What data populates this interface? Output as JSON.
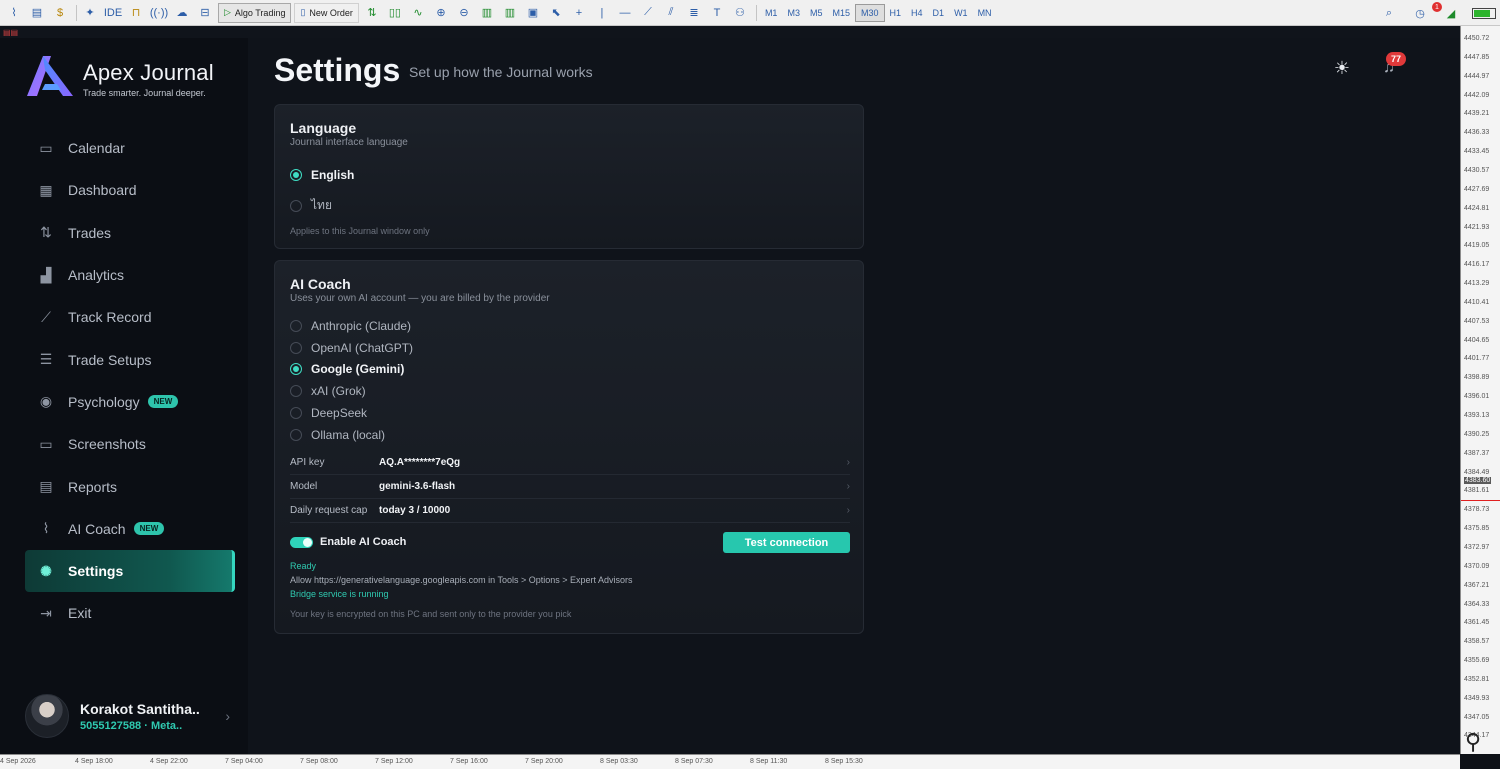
{
  "toolbar": {
    "algo_trading": "Algo Trading",
    "new_order": "New Order",
    "ide": "IDE",
    "timeframes": [
      "M1",
      "M3",
      "M5",
      "M15",
      "M30",
      "H1",
      "H4",
      "D1",
      "W1",
      "MN"
    ],
    "active_timeframe": "M30",
    "alert_count": "1"
  },
  "app": {
    "name": "Apex Journal",
    "tagline": "Trade smarter. Journal deeper."
  },
  "nav": [
    {
      "label": "Calendar",
      "icon": "calendar-icon"
    },
    {
      "label": "Dashboard",
      "icon": "dashboard-grid-icon"
    },
    {
      "label": "Trades",
      "icon": "trades-arrows-icon"
    },
    {
      "label": "Analytics",
      "icon": "bar-chart-icon"
    },
    {
      "label": "Track Record",
      "icon": "line-chart-icon"
    },
    {
      "label": "Trade Setups",
      "icon": "sliders-icon"
    },
    {
      "label": "Psychology",
      "icon": "target-icon",
      "badge": "NEW"
    },
    {
      "label": "Screenshots",
      "icon": "image-icon"
    },
    {
      "label": "Reports",
      "icon": "document-icon"
    },
    {
      "label": "AI Coach",
      "icon": "pulse-icon",
      "badge": "NEW"
    },
    {
      "label": "Settings",
      "icon": "gear-icon",
      "active": true
    },
    {
      "label": "Exit",
      "icon": "exit-icon"
    }
  ],
  "user": {
    "name": "Korakot Santitha..",
    "account": "5055127588",
    "platform": "Meta.."
  },
  "header": {
    "title": "Settings",
    "subtitle": "Set up how the Journal works",
    "notification_count": "77"
  },
  "language": {
    "title": "Language",
    "subtitle": "Journal interface language",
    "options": [
      "English",
      "ไทย"
    ],
    "selected": "English",
    "note": "Applies to this Journal window only"
  },
  "ai_coach": {
    "title": "AI Coach",
    "subtitle": "Uses your own AI account — you are billed by the provider",
    "providers": [
      "Anthropic (Claude)",
      "OpenAI (ChatGPT)",
      "Google (Gemini)",
      "xAI (Grok)",
      "DeepSeek",
      "Ollama (local)"
    ],
    "selected": "Google (Gemini)",
    "fields": [
      {
        "label": "API key",
        "value": "AQ.A********7eQg"
      },
      {
        "label": "Model",
        "value": "gemini-3.6-flash"
      },
      {
        "label": "Daily request cap",
        "value": "today 3 / 10000"
      }
    ],
    "enable_label": "Enable AI Coach",
    "enabled": true,
    "test_button": "Test connection",
    "status_ready": "Ready",
    "status_allow": "Allow https://generativelanguage.googleapis.com in Tools > Options > Expert Advisors",
    "status_bridge": "Bridge service is running",
    "footnote": "Your key is encrypted on this PC and sent only to the provider you pick"
  },
  "price_axis": [
    "4450.72",
    "4447.85",
    "4444.97",
    "4442.09",
    "4439.21",
    "4436.33",
    "4433.45",
    "4430.57",
    "4427.69",
    "4424.81",
    "4421.93",
    "4419.05",
    "4416.17",
    "4413.29",
    "4410.41",
    "4407.53",
    "4404.65",
    "4401.77",
    "4398.89",
    "4396.01",
    "4393.13",
    "4390.25",
    "4387.37",
    "4384.49",
    "4383.60",
    "4381.61",
    "4378.73",
    "4375.85",
    "4372.97",
    "4370.09",
    "4367.21",
    "4364.33",
    "4361.45",
    "4358.57",
    "4355.69",
    "4352.81",
    "4349.93",
    "4347.05",
    "4344.17"
  ],
  "current_price": "4383.60",
  "time_axis": [
    "4 Sep 2026",
    "4 Sep 18:00",
    "4 Sep 22:00",
    "7 Sep 04:00",
    "7 Sep 08:00",
    "7 Sep 12:00",
    "7 Sep 16:00",
    "7 Sep 20:00",
    "8 Sep 03:30",
    "8 Sep 07:30",
    "8 Sep 11:30",
    "8 Sep 15:30"
  ],
  "colors": {
    "accent": "#2fd3ba",
    "background": "#0f131a",
    "sidebar": "#0b0e14",
    "card": "#1a1e26",
    "badge_red": "#e0393a"
  }
}
